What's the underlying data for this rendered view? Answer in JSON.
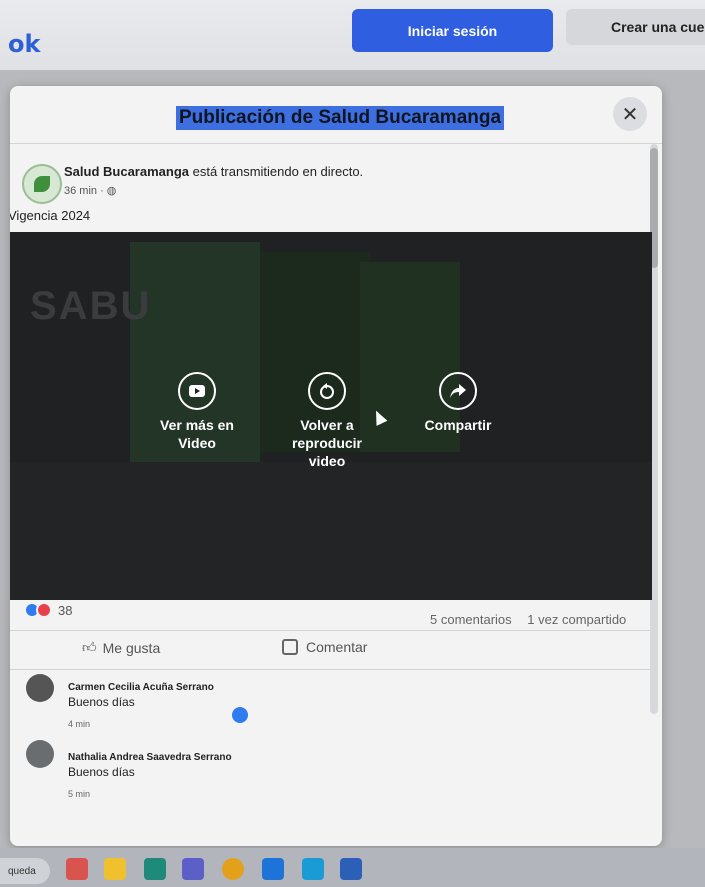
{
  "top_bar": {
    "brand": "ok",
    "login_label": "Iniciar sesión",
    "create_label": "Crear una cue"
  },
  "modal": {
    "title": "Publicación de Salud Bucaramanga",
    "close_icon": "close-icon"
  },
  "post": {
    "author": "Salud Bucaramanga",
    "status": "está transmitiendo en directo.",
    "time": "36 min · ",
    "audience_icon": "globe-icon",
    "text": "Vigencia 2024",
    "video_overlay_text": "SABU",
    "video_actions": [
      {
        "label": "Ver más en Video",
        "icon": "video-icon"
      },
      {
        "label": "Volver a reproducir video",
        "icon": "replay-icon"
      },
      {
        "label": "Compartir",
        "icon": "share-icon"
      }
    ]
  },
  "engagement": {
    "reaction_count": "38",
    "comments": "5 comentarios",
    "shares": "1 vez compartido",
    "like_label": "Me gusta",
    "comment_label": "Comentar"
  },
  "comments": [
    {
      "name": "Carmen Cecilia Acuña Serrano",
      "text": "Buenos días",
      "time": "4 min"
    },
    {
      "name": "Nathalia Andrea Saavedra Serrano",
      "text": "Buenos días",
      "time": "5 min"
    }
  ],
  "taskbar": {
    "search_label": "queda"
  },
  "colors": {
    "brand_blue": "#2d5fd6",
    "button_blue": "#2f5fe0",
    "like_blue": "#2f7bf0",
    "love_red": "#e8414a"
  }
}
